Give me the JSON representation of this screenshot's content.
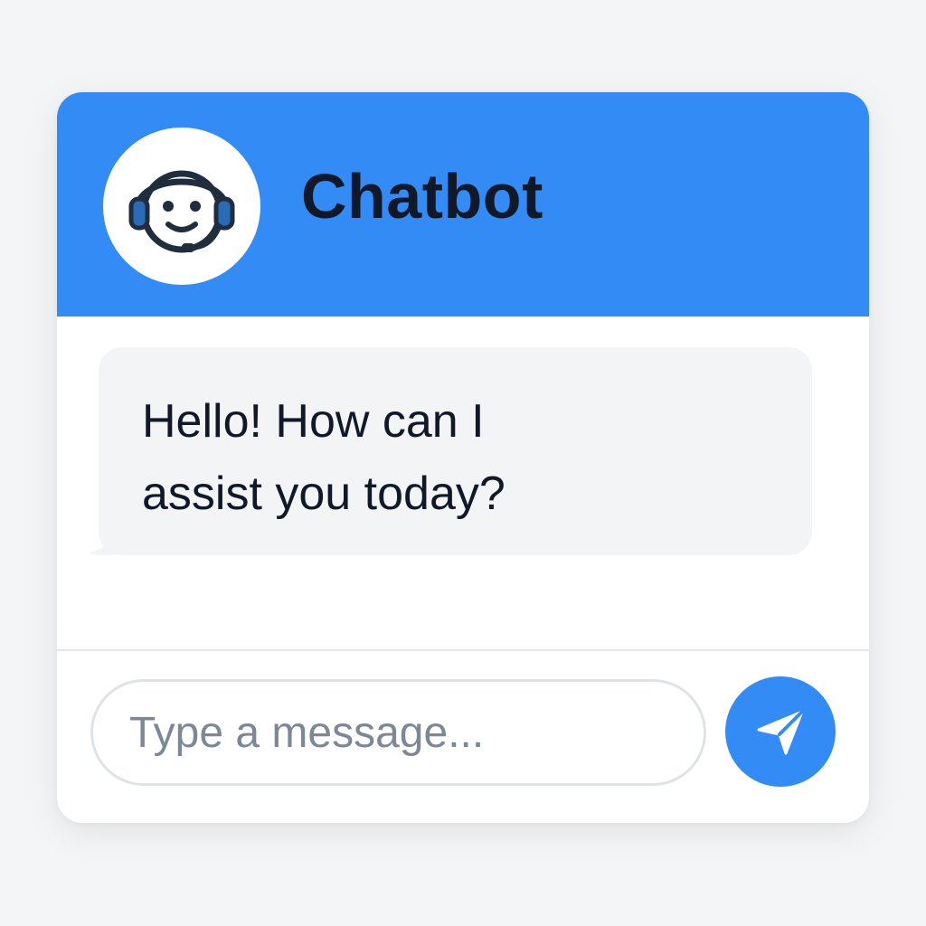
{
  "header": {
    "title": "Chatbot",
    "avatar_icon": "headset-bot-icon"
  },
  "messages": [
    {
      "sender": "bot",
      "lines": [
        "Hello! How can I",
        "assist you today?"
      ]
    }
  ],
  "composer": {
    "placeholder": "Type a message...",
    "value": "",
    "send_icon": "paper-plane-icon"
  },
  "colors": {
    "accent": "#338cf6",
    "background": "#f4f5f6",
    "bubble": "#f3f4f6",
    "text": "#111827",
    "placeholder": "#7d8897"
  }
}
